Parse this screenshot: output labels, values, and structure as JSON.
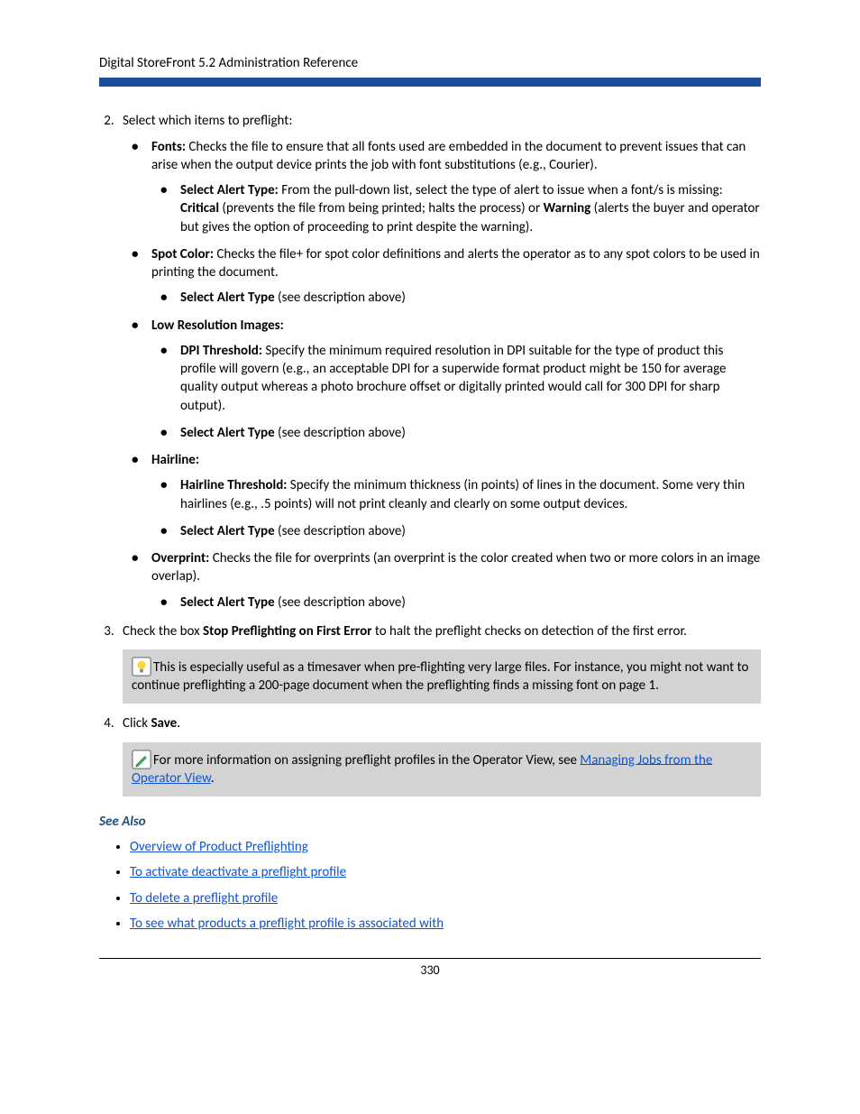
{
  "header": {
    "title": "Digital StoreFront 5.2 Administration Reference"
  },
  "steps": {
    "step2": {
      "intro": "Select which items to preflight:",
      "fonts": {
        "label": "Fonts:",
        "desc": " Checks the file to ensure that all fonts used are embedded in the document to prevent issues that can arise when the output device prints the job with font substitutions (e.g., Courier).",
        "alert_label": "Select Alert Type:",
        "alert_desc_1": " From the pull-down list, select the type of alert to issue when a font/s is missing: ",
        "critical": "Critical",
        "alert_desc_2": " (prevents the file from being printed; halts the process) or ",
        "warning": "Warning",
        "alert_desc_3": " (alerts the buyer and operator but gives the option of proceeding to print despite the warning)."
      },
      "spot": {
        "label": "Spot Color:",
        "desc": " Checks the file+ for spot color definitions and alerts the operator as to any spot colors to be used in printing the document.",
        "alert_label": "Select Alert Type",
        "alert_desc": " (see description above)"
      },
      "lowres": {
        "label": "Low Resolution Images:",
        "dpi_label": "DPI Threshold:",
        "dpi_desc": " Specify the minimum required resolution in DPI suitable for the type of product this profile will govern (e.g., an acceptable DPI for a superwide format product might be 150 for average quality output whereas a photo brochure offset or digitally printed would call for 300 DPI for sharp output).",
        "alert_label": "Select Alert Type",
        "alert_desc": " (see description above)"
      },
      "hairline": {
        "label": "Hairline:",
        "thresh_label": "Hairline Threshold:",
        "thresh_desc": " Specify the minimum thickness (in points) of lines in the document. Some very thin hairlines (e.g., .5 points) will not print cleanly and clearly on some output devices.",
        "alert_label": "Select Alert Type",
        "alert_desc": " (see description above)"
      },
      "overprint": {
        "label": "Overprint:",
        "desc": " Checks the file for overprints (an overprint is the color created when two or more colors in an image overlap).",
        "alert_label": "Select Alert Type",
        "alert_desc": " (see description above)"
      }
    },
    "step3": {
      "pre": "Check the box ",
      "bold": "Stop Preflighting on First Error",
      "post": " to halt the preflight checks on detection of the first error.",
      "tip": "This is especially useful as a timesaver when pre-flighting very large files. For instance, you might not want to continue preflighting a 200-page document when the preflighting finds a missing font on page 1."
    },
    "step4": {
      "pre": "Click ",
      "bold": "Save",
      "post": ".",
      "note_pre": "For more information on assigning preflight profiles in the Operator View, see ",
      "note_link": "Managing Jobs from the Operator View",
      "note_post": "."
    }
  },
  "see_also": {
    "heading": "See Also",
    "links": [
      "Overview of Product Preflighting",
      "To activate deactivate a preflight profile",
      "To delete a preflight profile",
      "To see what products a preflight profile is associated with"
    ]
  },
  "footer": {
    "page": "330"
  }
}
